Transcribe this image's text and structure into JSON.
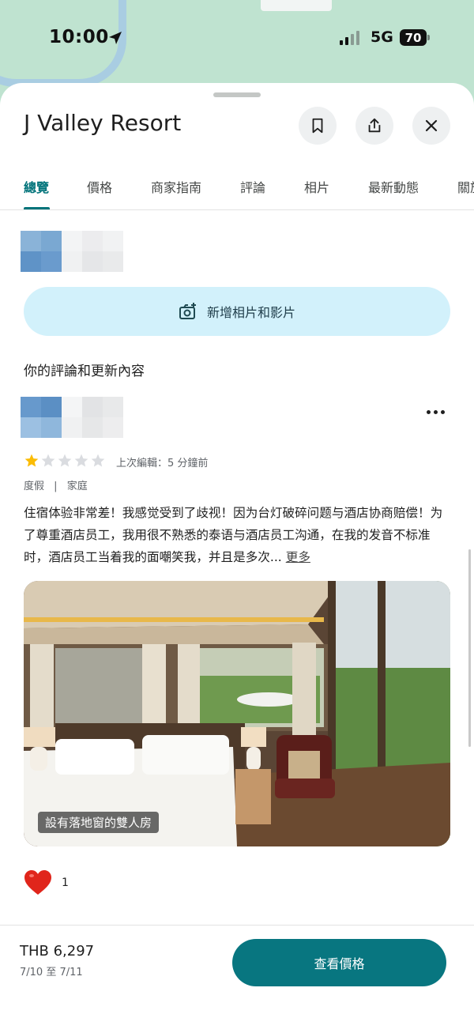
{
  "status_bar": {
    "time": "10:00",
    "network": "5G",
    "battery": "70"
  },
  "place": {
    "name": "J Valley Resort"
  },
  "header_icons": [
    "bookmark-icon",
    "share-icon",
    "close-icon"
  ],
  "tabs": [
    {
      "label": "總覽",
      "active": true
    },
    {
      "label": "價格"
    },
    {
      "label": "商家指南"
    },
    {
      "label": "評論"
    },
    {
      "label": "相片"
    },
    {
      "label": "最新動態"
    },
    {
      "label": "關於"
    }
  ],
  "add_media": {
    "label": "新增相片和影片"
  },
  "your_reviews": {
    "heading": "你的評論和更新內容"
  },
  "review": {
    "rating": 1,
    "max_rating": 5,
    "edited": "上次編輯：5 分鐘前",
    "tags": [
      "度假",
      "家庭"
    ],
    "text": "住宿体验非常差！我感觉受到了歧视！因为台灯破碎问题与酒店协商赔偿！为了尊重酒店员工，我用很不熟悉的泰语与酒店员工沟通，在我的发音不标准时，酒店员工当着我的面嘲笑我，并且是多次...",
    "more_label": "更多",
    "photo_caption": "設有落地窗的雙人房",
    "likes": "1"
  },
  "footer": {
    "price": "THB 6,297",
    "dates": "7/10 至 7/11",
    "cta_label": "查看價格"
  },
  "colors": {
    "accent": "#00737a",
    "cta": "#087680",
    "add_media_bg": "#d2f1fb",
    "star": "#fbbc04"
  }
}
